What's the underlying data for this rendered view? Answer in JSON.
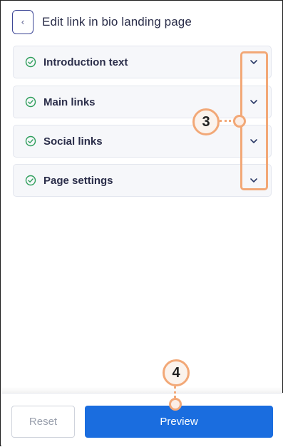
{
  "header": {
    "back_icon": "chevron-left-icon",
    "back_glyph": "‹",
    "title": "Edit link in bio landing page"
  },
  "sections": [
    {
      "label": "Introduction text",
      "status_icon": "check-circle-icon",
      "expand_icon": "chevron-down-icon"
    },
    {
      "label": "Main links",
      "status_icon": "check-circle-icon",
      "expand_icon": "chevron-down-icon"
    },
    {
      "label": "Social links",
      "status_icon": "check-circle-icon",
      "expand_icon": "chevron-down-icon"
    },
    {
      "label": "Page settings",
      "status_icon": "check-circle-icon",
      "expand_icon": "chevron-down-icon"
    }
  ],
  "annotations": {
    "callout_3": "3",
    "callout_4": "4"
  },
  "footer": {
    "reset_label": "Reset",
    "preview_label": "Preview"
  },
  "colors": {
    "accent": "#1a6ddf",
    "success": "#2e9e5b",
    "callout": "#f2a877"
  }
}
